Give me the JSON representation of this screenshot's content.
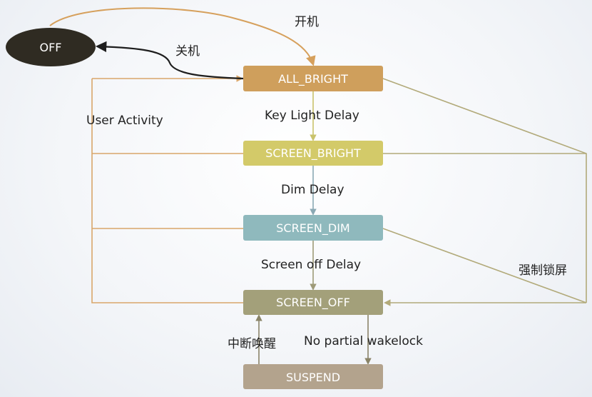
{
  "nodes": {
    "off": {
      "label": "OFF",
      "color": "#2f2b22"
    },
    "all_bright": {
      "label": "ALL_BRIGHT",
      "color": "#cf9f5c"
    },
    "screen_bright": {
      "label": "SCREEN_BRIGHT",
      "color": "#d3ca69"
    },
    "screen_dim": {
      "label": "SCREEN_DIM",
      "color": "#8fb9bd"
    },
    "screen_off": {
      "label": "SCREEN_OFF",
      "color": "#a3a07a"
    },
    "suspend": {
      "label": "SUSPEND",
      "color": "#b3a38d"
    }
  },
  "edges": {
    "power_on": "开机",
    "power_off": "关机",
    "user_activity": "User Activity",
    "key_light_delay": "Key Light Delay",
    "dim_delay": "Dim Delay",
    "screen_off_delay": "Screen off Delay",
    "force_lock": "强制锁屏",
    "interrupt_wake": "中断唤醒",
    "no_partial_wakelock": "No partial wakelock"
  },
  "colors": {
    "user_activity_line": "#d9a66a",
    "force_lock_line": "#b2aa7a",
    "key_light_arrow": "#c9c36a",
    "dim_arrow": "#8aa9b4",
    "screen_off_arrow": "#9e9a78",
    "suspend_arrows": "#8a8468",
    "power_on_arrow": "#d6a05c",
    "power_off_arrow": "#1e1e1e"
  }
}
